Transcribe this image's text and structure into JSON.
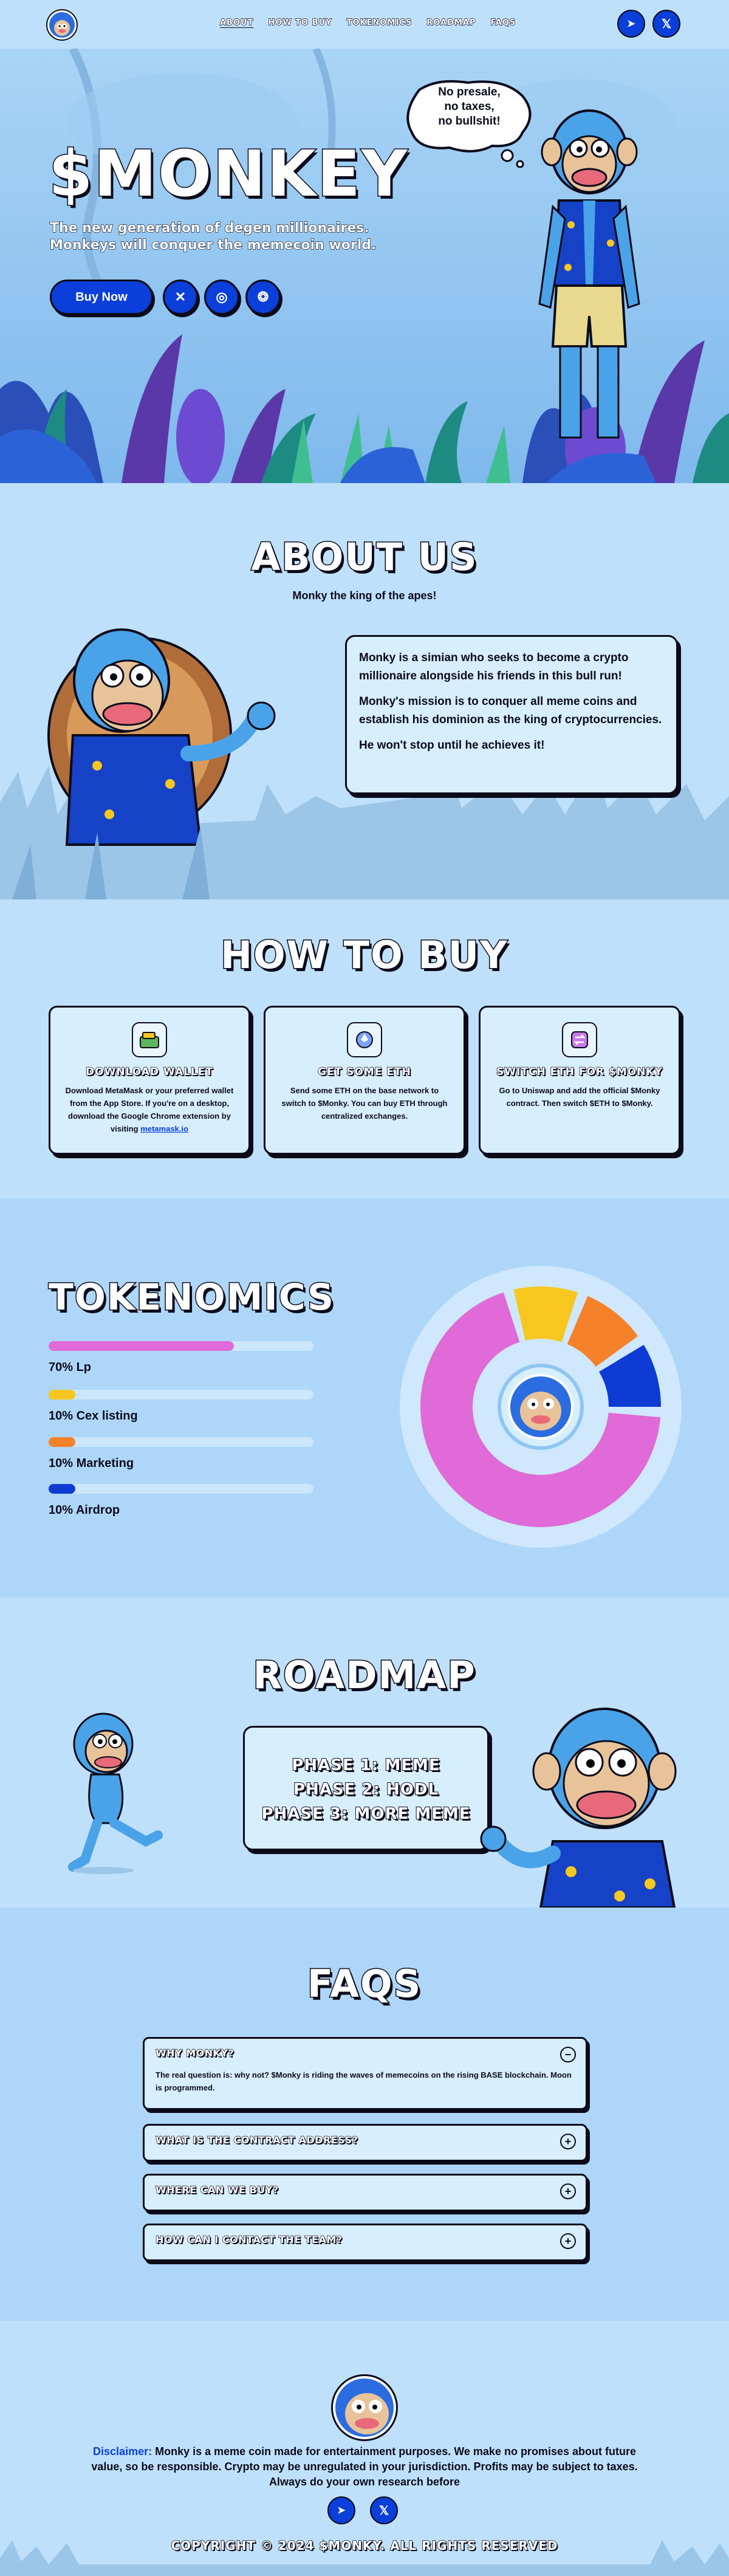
{
  "nav": {
    "links": [
      "ABOUT",
      "HOW TO BUY",
      "TOKENOMICS",
      "ROADMAP",
      "FAQS"
    ],
    "active": "ABOUT",
    "socials": [
      {
        "name": "telegram-icon",
        "glyph": "➤"
      },
      {
        "name": "x-icon",
        "glyph": "𝕏"
      }
    ]
  },
  "hero": {
    "title": "$MONKEY",
    "subtitle_line1": "The new generation of degen millionaires.",
    "subtitle_line2": "Monkeys will conquer the memecoin world.",
    "buy_label": "Buy Now",
    "speech_line1": "No presale,",
    "speech_line2": "no taxes,",
    "speech_line3": "no bullshit!"
  },
  "about": {
    "title": "ABOUT US",
    "subtitle": "Monky the king of the apes!",
    "p1": "Monky is a simian who seeks to become a crypto millionaire alongside his friends in this bull run!",
    "p2": "Monky's mission is to conquer all meme coins and establish his dominion as the king of cryptocurrencies.",
    "p3": "He won't stop until he achieves it!"
  },
  "how_to_buy": {
    "title": "HOW TO BUY",
    "cards": [
      {
        "title": "DOWNLOAD WALLET",
        "desc": "Download MetaMask or your preferred wallet from the App Store. If you're on a desktop, download the Google Chrome extension by visiting",
        "link": "metamask.io",
        "icon": "wallet-icon"
      },
      {
        "title": "GET SOME ETH",
        "desc": "Send some ETH on the base network to switch to $Monky. You can buy ETH through centralized exchanges.",
        "icon": "eth-icon"
      },
      {
        "title": "SWITCH ETH FOR $MONKY",
        "desc": "Go to Uniswap and add the official $Monky contract. Then switch $ETH to $Monky.",
        "icon": "swap-icon"
      }
    ]
  },
  "tokenomics": {
    "title": "TOKENOMICS",
    "items": [
      {
        "label": "70% Lp",
        "percent": 70,
        "color": "#e06ad8"
      },
      {
        "label": "10% Cex listing",
        "percent": 10,
        "color": "#f7c71f"
      },
      {
        "label": "10% Marketing",
        "percent": 10,
        "color": "#f5822a"
      },
      {
        "label": "10% Airdrop",
        "percent": 10,
        "color": "#0d3bd4"
      }
    ]
  },
  "roadmap": {
    "title": "ROADMAP",
    "phases": [
      "PHASE 1: MEME",
      "PHASE 2: HODL",
      "PHASE 3: MORE MEME"
    ]
  },
  "faqs": {
    "title": "FAQS",
    "items": [
      {
        "q": "WHY MONKY?",
        "a": "The real question is: why not? $Monky is riding the waves of memecoins on the rising BASE blockchain. Moon is programmed.",
        "open": true
      },
      {
        "q": "WHAT IS THE CONTRACT ADDRESS?",
        "open": false
      },
      {
        "q": "WHERE CAN WE BUY?",
        "open": false
      },
      {
        "q": "HOW CAN I CONTACT THE TEAM?",
        "open": false
      }
    ]
  },
  "footer": {
    "disclaimer_label": "Disclaimer:",
    "disclaimer_text": "Monky is a meme coin made for entertainment purposes. We make no promises about future value, so be responsible. Crypto may be unregulated in your jurisdiction. Profits may be subject to taxes. Always do your own research before",
    "copyright": "COPYRIGHT © 2024 $MONKY. ALL RIGHTS RESERVED"
  }
}
